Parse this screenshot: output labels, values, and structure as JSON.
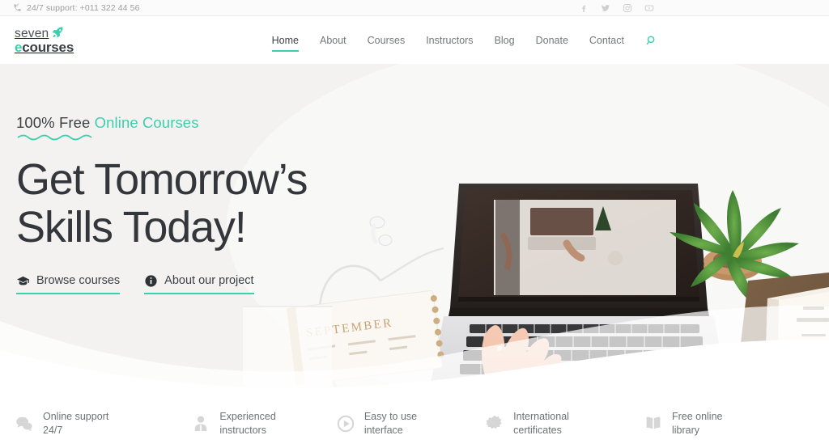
{
  "topbar": {
    "phone_icon": "phone-ring-icon",
    "support_text": "24/7 support: +011 322 44 56",
    "social": [
      {
        "name": "facebook-icon",
        "label": "Facebook"
      },
      {
        "name": "twitter-icon",
        "label": "Twitter"
      },
      {
        "name": "instagram-icon",
        "label": "Instagram"
      },
      {
        "name": "youtube-icon",
        "label": "YouTube"
      }
    ]
  },
  "header": {
    "logo": {
      "line1": "seven",
      "line2_accent": "e",
      "line2_rest": "courses",
      "icon": "rocket-icon"
    },
    "nav": [
      {
        "label": "Home",
        "active": true
      },
      {
        "label": "About",
        "active": false
      },
      {
        "label": "Courses",
        "active": false
      },
      {
        "label": "Instructors",
        "active": false
      },
      {
        "label": "Blog",
        "active": false
      },
      {
        "label": "Donate",
        "active": false
      },
      {
        "label": "Contact",
        "active": false
      }
    ],
    "search_icon": "search-icon"
  },
  "hero": {
    "eyebrow_plain": "100% Free ",
    "eyebrow_accent": "Online Courses",
    "headline_line1": "Get Tomorrow’s",
    "headline_line2": "Skills Today!",
    "cta_primary": {
      "label": "Browse courses",
      "icon": "graduation-cap-icon"
    },
    "cta_secondary": {
      "label": "About our project",
      "icon": "info-circle-icon"
    },
    "photo_description": "Flat-lay desk photo with laptop, hands typing, earbuds, potted plant, open book and September planner"
  },
  "features": [
    {
      "icon": "chat-bubbles-icon",
      "line1": "Online support",
      "line2": "24/7"
    },
    {
      "icon": "person-icon",
      "line1": "Experienced",
      "line2": "instructors"
    },
    {
      "icon": "play-circle-icon",
      "line1": "Easy to use",
      "line2": "interface"
    },
    {
      "icon": "certificate-seal-icon",
      "line1": "International",
      "line2": "certificates"
    },
    {
      "icon": "open-book-icon",
      "line1": "Free online",
      "line2": "library"
    }
  ],
  "colors": {
    "accent_teal": "#3ccfae",
    "text_dark": "#33373c",
    "text_muted": "#74787c",
    "hero_bg": "#f2f1ef",
    "topbar_bg": "#fbfbfb"
  }
}
